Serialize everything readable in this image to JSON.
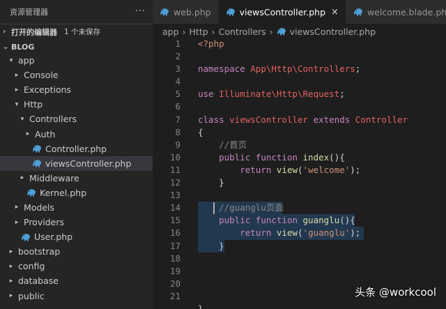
{
  "sidebar": {
    "title": "资源管理器",
    "more": "···",
    "open_editors": {
      "label": "打开的编辑器",
      "badge": "1 个未保存"
    },
    "project": {
      "label": "BLOG"
    },
    "tree": [
      {
        "label": "app",
        "depth": 0,
        "twisty": "▾",
        "type": "folder"
      },
      {
        "label": "Console",
        "depth": 1,
        "twisty": "▸",
        "type": "folder"
      },
      {
        "label": "Exceptions",
        "depth": 1,
        "twisty": "▸",
        "type": "folder"
      },
      {
        "label": "Http",
        "depth": 1,
        "twisty": "▾",
        "type": "folder"
      },
      {
        "label": "Controllers",
        "depth": 2,
        "twisty": "▾",
        "type": "folder"
      },
      {
        "label": "Auth",
        "depth": 3,
        "twisty": "▸",
        "type": "folder"
      },
      {
        "label": "Controller.php",
        "depth": 3,
        "twisty": "",
        "type": "file"
      },
      {
        "label": "viewsController.php",
        "depth": 3,
        "twisty": "",
        "type": "file",
        "selected": true
      },
      {
        "label": "Middleware",
        "depth": 2,
        "twisty": "▸",
        "type": "folder"
      },
      {
        "label": "Kernel.php",
        "depth": 2,
        "twisty": "",
        "type": "file"
      },
      {
        "label": "Models",
        "depth": 1,
        "twisty": "▸",
        "type": "folder"
      },
      {
        "label": "Providers",
        "depth": 1,
        "twisty": "▸",
        "type": "folder"
      },
      {
        "label": "User.php",
        "depth": 1,
        "twisty": "",
        "type": "file"
      },
      {
        "label": "bootstrap",
        "depth": 0,
        "twisty": "▸",
        "type": "folder"
      },
      {
        "label": "config",
        "depth": 0,
        "twisty": "▸",
        "type": "folder"
      },
      {
        "label": "database",
        "depth": 0,
        "twisty": "▸",
        "type": "folder"
      },
      {
        "label": "public",
        "depth": 0,
        "twisty": "▸",
        "type": "folder"
      }
    ]
  },
  "tabs": [
    {
      "label": "web.php",
      "active": false
    },
    {
      "label": "viewsController.php",
      "active": true,
      "close": "×"
    },
    {
      "label": "welcome.blade.php",
      "active": false
    }
  ],
  "breadcrumb": [
    "app",
    "Http",
    "Controllers",
    "viewsController.php"
  ],
  "breadcrumb_sep": "›",
  "code_lines": [
    {
      "n": "1",
      "parts": [
        [
          "str",
          "<?php"
        ]
      ]
    },
    {
      "n": "2",
      "parts": []
    },
    {
      "n": "3",
      "parts": [
        [
          "k",
          "namespace "
        ],
        [
          "cls",
          "App\\Http\\Controllers"
        ],
        [
          "p",
          ";"
        ]
      ]
    },
    {
      "n": "4",
      "parts": []
    },
    {
      "n": "5",
      "parts": [
        [
          "k",
          "use "
        ],
        [
          "cls",
          "Illuminate\\Http\\Request"
        ],
        [
          "p",
          ";"
        ]
      ]
    },
    {
      "n": "6",
      "parts": []
    },
    {
      "n": "7",
      "parts": [
        [
          "k",
          "class "
        ],
        [
          "cls",
          "viewsController "
        ],
        [
          "k",
          "extends "
        ],
        [
          "cls",
          "Controller"
        ]
      ]
    },
    {
      "n": "8",
      "parts": [
        [
          "p",
          "{"
        ]
      ]
    },
    {
      "n": "9",
      "parts": [
        [
          "p",
          "    "
        ],
        [
          "cm",
          "//首页"
        ]
      ]
    },
    {
      "n": "10",
      "parts": [
        [
          "p",
          "    "
        ],
        [
          "k",
          "public function "
        ],
        [
          "fn",
          "index"
        ],
        [
          "p",
          "(){"
        ]
      ]
    },
    {
      "n": "11",
      "parts": [
        [
          "p",
          "        "
        ],
        [
          "k",
          "return "
        ],
        [
          "fn",
          "view"
        ],
        [
          "p",
          "("
        ],
        [
          "str",
          "'welcome'"
        ],
        [
          "p",
          ");"
        ]
      ]
    },
    {
      "n": "12",
      "parts": [
        [
          "p",
          "    }"
        ]
      ]
    },
    {
      "n": "13",
      "parts": []
    },
    {
      "n": "14",
      "parts": [
        [
          "p",
          "    "
        ],
        [
          "cm",
          "//guanglu页面"
        ]
      ],
      "selected": true,
      "cursor": true
    },
    {
      "n": "15",
      "parts": [
        [
          "p",
          "    "
        ],
        [
          "k",
          "public function "
        ],
        [
          "fn",
          "guanglu"
        ],
        [
          "p",
          "(){"
        ]
      ],
      "selected": true
    },
    {
      "n": "16",
      "parts": [
        [
          "p",
          "        "
        ],
        [
          "k",
          "return "
        ],
        [
          "fn",
          "view"
        ],
        [
          "p",
          "("
        ],
        [
          "str",
          "'guanglu'"
        ],
        [
          "p",
          ");"
        ]
      ],
      "selected": true
    },
    {
      "n": "17",
      "parts": [
        [
          "p",
          "    }"
        ]
      ],
      "selected": true
    },
    {
      "n": "18",
      "parts": []
    },
    {
      "n": "19",
      "parts": []
    },
    {
      "n": "20",
      "parts": []
    },
    {
      "n": "21",
      "parts": []
    },
    {
      "n": "",
      "parts": [
        [
          "p",
          "}"
        ]
      ]
    }
  ],
  "watermark": "头条 @workcool",
  "colors": {
    "keyword": "#c586c0",
    "class_name": "#e36262",
    "string": "#ce9178",
    "function": "#dcdcaa",
    "comment": "#8a8a8a",
    "php_icon": "#4f9fd6"
  },
  "icons": {
    "php_file": "elephant-php-icon"
  }
}
